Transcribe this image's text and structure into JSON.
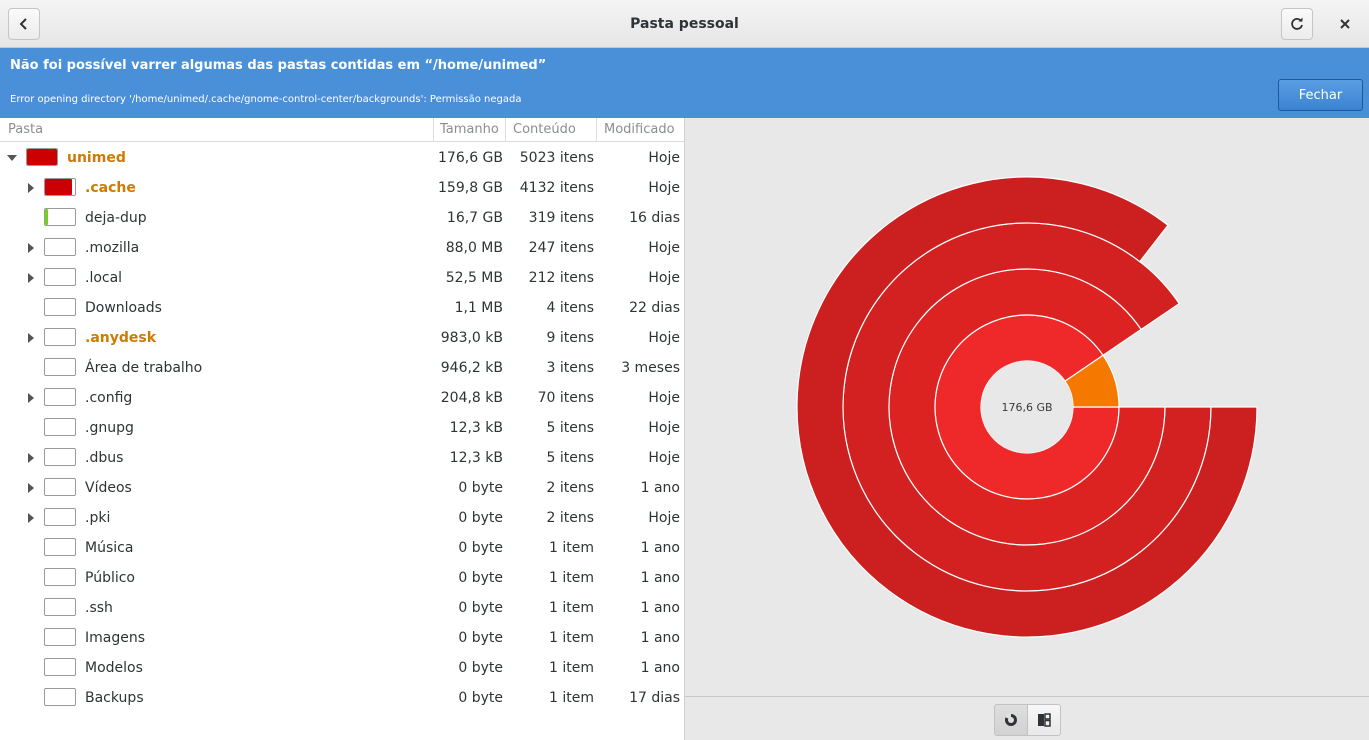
{
  "header": {
    "title": "Pasta pessoal"
  },
  "infobar": {
    "primary": "Não foi possível varrer algumas das pastas contidas em “/home/unimed”",
    "secondary": "Error opening directory '/home/unimed/.cache/gnome-control-center/backgrounds': Permissão negada",
    "close_label": "Fechar"
  },
  "columns": {
    "folder": "Pasta",
    "size": "Tamanho",
    "contents": "Conteúdo",
    "modified": "Modificado"
  },
  "rows": [
    {
      "name": "unimed",
      "size": "176,6 GB",
      "contents": "5023 itens",
      "modified": "Hoje",
      "fill": 1.0,
      "fill_color": "#cc0000",
      "highlight": true,
      "expander": "open",
      "indent": 0
    },
    {
      "name": ".cache",
      "size": "159,8 GB",
      "contents": "4132 itens",
      "modified": "Hoje",
      "fill": 0.905,
      "fill_color": "#cc0000",
      "highlight": true,
      "expander": "closed",
      "indent": 1
    },
    {
      "name": "deja-dup",
      "size": "16,7 GB",
      "contents": "319 itens",
      "modified": "16 dias",
      "fill": 0.095,
      "fill_color": "#73d216",
      "highlight": false,
      "expander": "none",
      "indent": 1
    },
    {
      "name": ".mozilla",
      "size": "88,0 MB",
      "contents": "247 itens",
      "modified": "Hoje",
      "fill": 0,
      "fill_color": "#73d216",
      "highlight": false,
      "expander": "closed",
      "indent": 1
    },
    {
      "name": ".local",
      "size": "52,5 MB",
      "contents": "212 itens",
      "modified": "Hoje",
      "fill": 0,
      "fill_color": "#73d216",
      "highlight": false,
      "expander": "closed",
      "indent": 1
    },
    {
      "name": "Downloads",
      "size": "1,1 MB",
      "contents": "4 itens",
      "modified": "22 dias",
      "fill": 0,
      "fill_color": "#73d216",
      "highlight": false,
      "expander": "none",
      "indent": 1
    },
    {
      "name": ".anydesk",
      "size": "983,0 kB",
      "contents": "9 itens",
      "modified": "Hoje",
      "fill": 0,
      "fill_color": "#73d216",
      "highlight": true,
      "expander": "closed",
      "indent": 1
    },
    {
      "name": "Área de trabalho",
      "size": "946,2 kB",
      "contents": "3 itens",
      "modified": "3 meses",
      "fill": 0,
      "fill_color": "#73d216",
      "highlight": false,
      "expander": "none",
      "indent": 1
    },
    {
      "name": ".config",
      "size": "204,8 kB",
      "contents": "70 itens",
      "modified": "Hoje",
      "fill": 0,
      "fill_color": "#73d216",
      "highlight": false,
      "expander": "closed",
      "indent": 1
    },
    {
      "name": ".gnupg",
      "size": "12,3 kB",
      "contents": "5 itens",
      "modified": "Hoje",
      "fill": 0,
      "fill_color": "#73d216",
      "highlight": false,
      "expander": "none",
      "indent": 1
    },
    {
      "name": ".dbus",
      "size": "12,3 kB",
      "contents": "5 itens",
      "modified": "Hoje",
      "fill": 0,
      "fill_color": "#73d216",
      "highlight": false,
      "expander": "closed",
      "indent": 1
    },
    {
      "name": "Vídeos",
      "size": "0 byte",
      "contents": "2 itens",
      "modified": "1 ano",
      "fill": 0,
      "fill_color": "#73d216",
      "highlight": false,
      "expander": "closed",
      "indent": 1
    },
    {
      "name": ".pki",
      "size": "0 byte",
      "contents": "2 itens",
      "modified": "Hoje",
      "fill": 0,
      "fill_color": "#73d216",
      "highlight": false,
      "expander": "closed",
      "indent": 1
    },
    {
      "name": "Música",
      "size": "0 byte",
      "contents": "1 item",
      "modified": "1 ano",
      "fill": 0,
      "fill_color": "#73d216",
      "highlight": false,
      "expander": "none",
      "indent": 1
    },
    {
      "name": "Público",
      "size": "0 byte",
      "contents": "1 item",
      "modified": "1 ano",
      "fill": 0,
      "fill_color": "#73d216",
      "highlight": false,
      "expander": "none",
      "indent": 1
    },
    {
      "name": ".ssh",
      "size": "0 byte",
      "contents": "1 item",
      "modified": "1 ano",
      "fill": 0,
      "fill_color": "#73d216",
      "highlight": false,
      "expander": "none",
      "indent": 1
    },
    {
      "name": "Imagens",
      "size": "0 byte",
      "contents": "1 item",
      "modified": "1 ano",
      "fill": 0,
      "fill_color": "#73d216",
      "highlight": false,
      "expander": "none",
      "indent": 1
    },
    {
      "name": "Modelos",
      "size": "0 byte",
      "contents": "1 item",
      "modified": "1 ano",
      "fill": 0,
      "fill_color": "#73d216",
      "highlight": false,
      "expander": "none",
      "indent": 1
    },
    {
      "name": "Backups",
      "size": "0 byte",
      "contents": "1 item",
      "modified": "17 dias",
      "fill": 0,
      "fill_color": "#73d216",
      "highlight": false,
      "expander": "none",
      "indent": 1
    }
  ],
  "ring_chart": {
    "center_label": "176,6 GB",
    "rings": [
      {
        "segments": [
          {
            "fraction": 0.905,
            "color": "#ef2929"
          },
          {
            "fraction": 0.095,
            "color": "#f57900"
          }
        ]
      },
      {
        "segments": [
          {
            "fraction": 0.905,
            "color": "#dd2222"
          }
        ]
      },
      {
        "segments": [
          {
            "fraction": 0.905,
            "color": "#d32020"
          }
        ]
      },
      {
        "segments": [
          {
            "fraction": 0.855,
            "color": "#cc1f1f"
          }
        ]
      }
    ]
  },
  "colors": {
    "accent": "#4a90d9",
    "highlight_text": "#ce7b00"
  },
  "icons": {
    "back": "go-previous-icon",
    "reload": "view-refresh-icon",
    "close": "window-close-icon",
    "ring": "ring-chart-icon",
    "treemap": "treemap-chart-icon"
  }
}
